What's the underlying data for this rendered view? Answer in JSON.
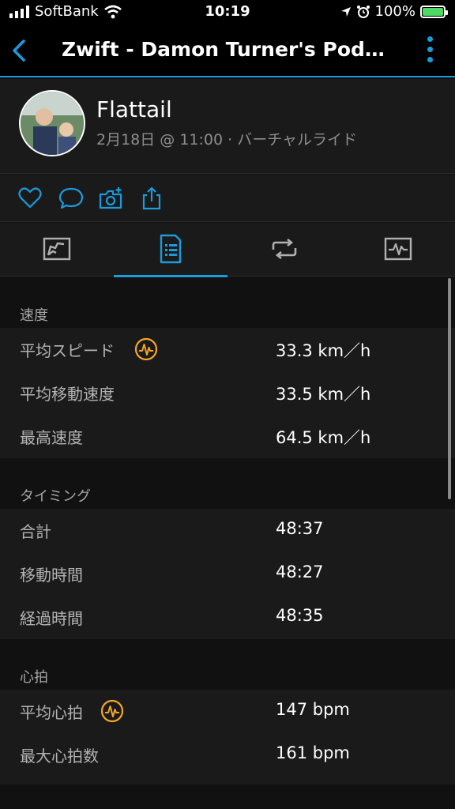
{
  "status_bar": {
    "carrier": "SoftBank",
    "time": "10:19",
    "battery": "100%"
  },
  "nav": {
    "title": "Zwift - Damon Turner's Podcast..."
  },
  "profile": {
    "name": "Flattail",
    "subtitle": "2月18日 @ 11:00 · バーチャルライド"
  },
  "actions": [
    "heart-icon",
    "comment-icon",
    "camera-add-icon",
    "share-icon"
  ],
  "tabs": [
    "overview-tab",
    "stats-tab",
    "laps-tab",
    "charts-tab"
  ],
  "active_tab": 1,
  "colors": {
    "accent": "#1a9bdc",
    "badge": "#f5a623",
    "background": "#111111",
    "row_background": "#1a1a1a"
  },
  "sections": {
    "speed": {
      "title": "速度",
      "rows": [
        {
          "label": "平均スピード",
          "value": "33.3 km／h",
          "badge": true
        },
        {
          "label": "平均移動速度",
          "value": "33.5 km／h"
        },
        {
          "label": "最高速度",
          "value": "64.5 km／h"
        }
      ]
    },
    "timing": {
      "title": "タイミング",
      "rows": [
        {
          "label": "合計",
          "value": "48:37"
        },
        {
          "label": "移動時間",
          "value": "48:27"
        },
        {
          "label": "経過時間",
          "value": "48:35"
        }
      ]
    },
    "heart_rate": {
      "title": "心拍",
      "rows": [
        {
          "label": "平均心拍",
          "value": "147 bpm",
          "badge": true
        },
        {
          "label": "最大心拍数",
          "value": "161 bpm"
        }
      ]
    }
  }
}
